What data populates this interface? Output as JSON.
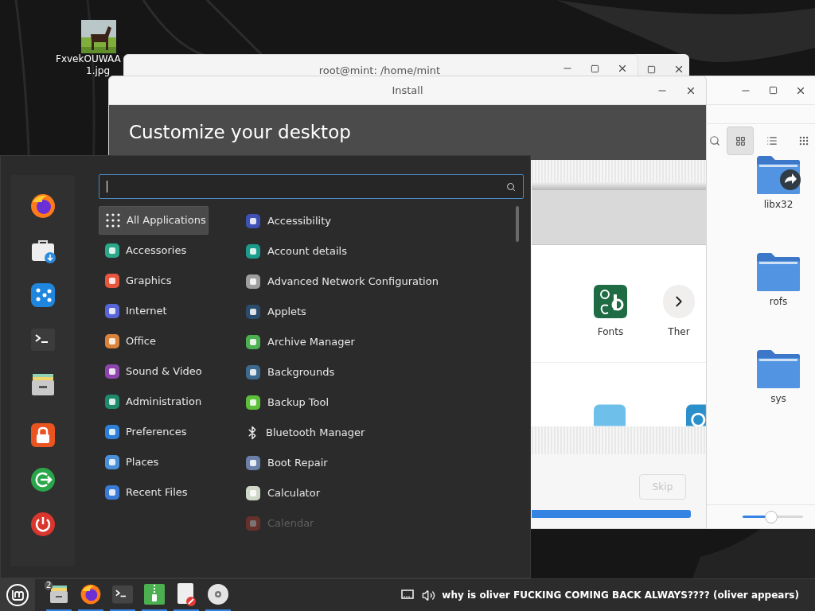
{
  "desktop_icons": [
    {
      "lines": [
        "FxvekOUWAA",
        "1.jpg"
      ]
    }
  ],
  "terminal_window": {
    "title": "root@mint: /home/mint"
  },
  "install_window": {
    "title": "Install",
    "heading": "Customize your desktop",
    "apps": [
      {
        "label": "Fonts",
        "kind": "fonts"
      },
      {
        "label": "Ther",
        "kind": "themes"
      }
    ],
    "skip_button": {
      "label": "Skip",
      "disabled": true
    },
    "progress": {
      "level": 1
    }
  },
  "file_manager": {
    "view_buttons": [
      {
        "kind": "grid",
        "selected": true
      },
      {
        "kind": "list",
        "selected": false
      },
      {
        "kind": "compact",
        "selected": false
      }
    ],
    "items": [
      {
        "name": "libx32",
        "kind": "link"
      },
      {
        "name": "rofs",
        "kind": "folder"
      },
      {
        "name": "sys",
        "kind": "folder"
      }
    ],
    "zoom": {
      "level": 0.47
    }
  },
  "menu": {
    "categories": [
      {
        "label": "All Applications",
        "selected": true
      },
      {
        "label": "Accessories",
        "selected": false
      },
      {
        "label": "Graphics",
        "selected": false
      },
      {
        "label": "Internet",
        "selected": false
      },
      {
        "label": "Office",
        "selected": false
      },
      {
        "label": "Sound & Video",
        "selected": false
      },
      {
        "label": "Administration",
        "selected": false
      },
      {
        "label": "Preferences",
        "selected": false
      },
      {
        "label": "Places",
        "selected": false
      },
      {
        "label": "Recent Files",
        "selected": false
      }
    ],
    "apps": [
      {
        "label": "Accessibility",
        "disabled": false
      },
      {
        "label": "Account details",
        "disabled": false
      },
      {
        "label": "Advanced Network Configuration",
        "disabled": false
      },
      {
        "label": "Applets",
        "disabled": false
      },
      {
        "label": "Archive Manager",
        "disabled": false
      },
      {
        "label": "Backgrounds",
        "disabled": false
      },
      {
        "label": "Backup Tool",
        "disabled": false
      },
      {
        "label": "Bluetooth Manager",
        "disabled": false
      },
      {
        "label": "Boot Repair",
        "disabled": false
      },
      {
        "label": "Calculator",
        "disabled": false
      },
      {
        "label": "Calendar",
        "disabled": true
      }
    ]
  },
  "taskbar": {
    "workspace_badge": "2",
    "status_text": "why is oliver FUCKING COMING BACK ALWAYS???? (oliver appears)"
  }
}
